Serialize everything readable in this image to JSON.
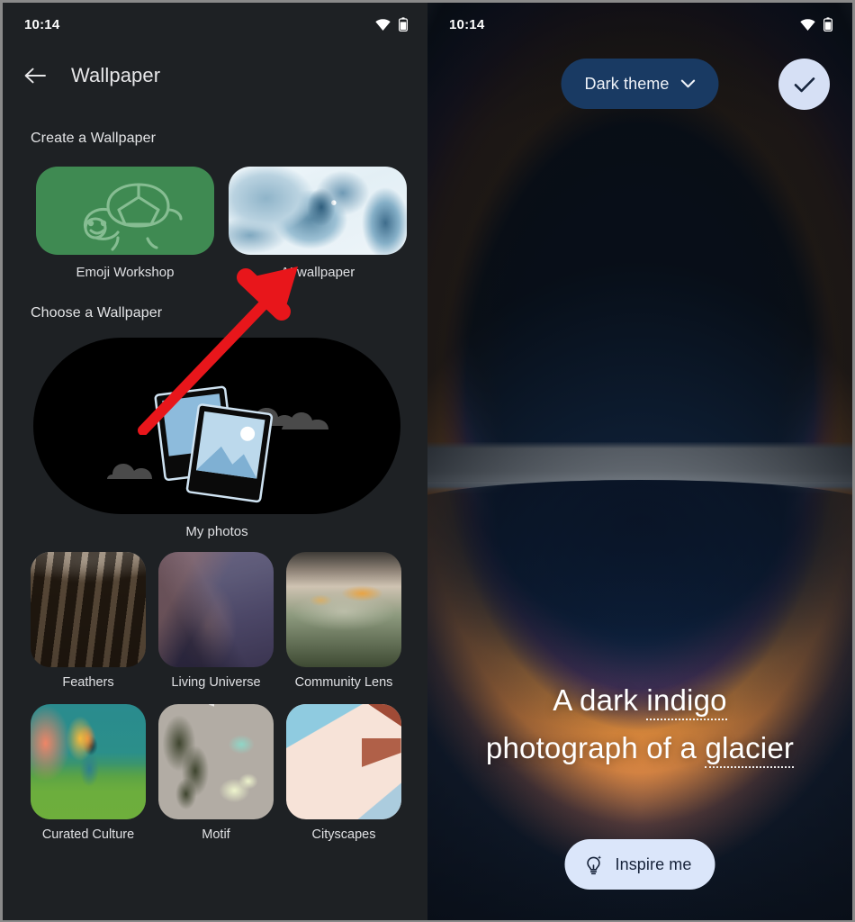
{
  "status_bar": {
    "time": "10:14",
    "wifi_icon": "wifi-icon",
    "battery_icon": "battery-icon"
  },
  "left_panel": {
    "app_bar": {
      "back_icon": "back-arrow-icon",
      "title": "Wallpaper"
    },
    "sections": {
      "create": {
        "title": "Create a Wallpaper",
        "items": [
          {
            "label": "Emoji Workshop",
            "art": "turtle-illustration",
            "color": "#3F8A52"
          },
          {
            "label": "AI wallpaper",
            "art": "snow-landscape-photo",
            "color": "#E3EFF5"
          }
        ]
      },
      "choose": {
        "title": "Choose a Wallpaper",
        "my_photos": {
          "label": "My photos",
          "art": "photo-stack-illustration",
          "color": "#000000"
        },
        "categories": [
          {
            "label": "Feathers"
          },
          {
            "label": "Living Universe"
          },
          {
            "label": "Community Lens"
          },
          {
            "label": "Curated Culture"
          },
          {
            "label": "Motif"
          },
          {
            "label": "Cityscapes"
          }
        ]
      }
    },
    "annotation": {
      "shape": "red-arrow",
      "color": "#E8161B",
      "points_at": "AI wallpaper"
    }
  },
  "right_panel": {
    "theme_chip": {
      "label": "Dark theme",
      "icon": "chevron-down-icon",
      "color": "#193A63"
    },
    "confirm_button": {
      "icon": "check-icon",
      "color": "#D6E0F5"
    },
    "prompt": {
      "before": "A dark ",
      "word1": "indigo",
      "middle": " photograph of a ",
      "word2": "glacier"
    },
    "inspire_button": {
      "label": "Inspire me",
      "icon": "lightbulb-sparkle-icon",
      "color": "#DBE6FA"
    },
    "wallpaper_art": "glacier-sunset-gradient"
  }
}
